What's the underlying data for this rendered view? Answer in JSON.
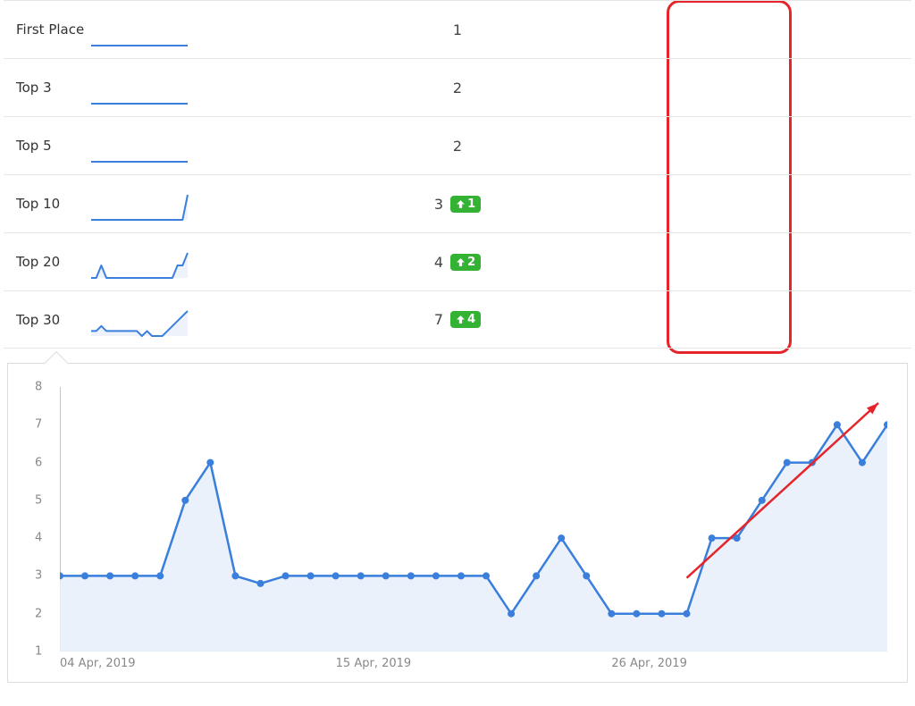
{
  "accent": "#3a7fdc",
  "success": "#34b233",
  "annotation": "#e4252b",
  "rows": [
    {
      "label": "First Place",
      "value": 1,
      "delta": null,
      "spark": [
        1,
        1,
        1,
        1,
        1,
        1,
        1,
        1,
        1,
        1,
        1,
        1,
        1,
        1,
        1,
        1,
        1,
        1,
        1,
        1
      ]
    },
    {
      "label": "Top 3",
      "value": 2,
      "delta": null,
      "spark": [
        2,
        2,
        2,
        2,
        2,
        2,
        2,
        2,
        2,
        2,
        2,
        2,
        2,
        2,
        2,
        2,
        2,
        2,
        2,
        2
      ]
    },
    {
      "label": "Top 5",
      "value": 2,
      "delta": null,
      "spark": [
        2,
        2,
        2,
        2,
        2,
        2,
        2,
        2,
        2,
        2,
        2,
        2,
        2,
        2,
        2,
        2,
        2,
        2,
        2,
        2
      ]
    },
    {
      "label": "Top 10",
      "value": 3,
      "delta": 1,
      "spark": [
        2,
        2,
        2,
        2,
        2,
        2,
        2,
        2,
        2,
        2,
        2,
        2,
        2,
        2,
        2,
        2,
        2,
        2,
        2,
        3
      ]
    },
    {
      "label": "Top 20",
      "value": 4,
      "delta": 2,
      "spark": [
        2,
        2,
        3,
        2,
        2,
        2,
        2,
        2,
        2,
        2,
        2,
        2,
        2,
        2,
        2,
        2,
        2,
        3,
        3,
        4
      ]
    },
    {
      "label": "Top 30",
      "value": 7,
      "delta": 4,
      "spark": [
        3,
        3,
        4,
        3,
        3,
        3,
        3,
        3,
        3,
        3,
        2,
        3,
        2,
        2,
        2,
        3,
        4,
        5,
        6,
        7
      ]
    }
  ],
  "chart_data": {
    "type": "area",
    "ylim": [
      1,
      8
    ],
    "yticks": [
      1,
      2,
      3,
      4,
      5,
      6,
      7,
      8
    ],
    "x_tick_labels": [
      "04 Apr, 2019",
      "15 Apr, 2019",
      "26 Apr, 2019"
    ],
    "x_tick_indices": [
      0,
      11,
      22
    ],
    "values": [
      3,
      3,
      3,
      3,
      3,
      5,
      6,
      3,
      2.8,
      3,
      3,
      3,
      3,
      3,
      3,
      3,
      3,
      3,
      2,
      3,
      4,
      3,
      2,
      2,
      2,
      2,
      4,
      4,
      5,
      6,
      6,
      7,
      6,
      7
    ]
  },
  "annotations": {
    "box_desc": "red rounded box around value column",
    "arrow_desc": "red trend arrow over rising tail of chart"
  }
}
